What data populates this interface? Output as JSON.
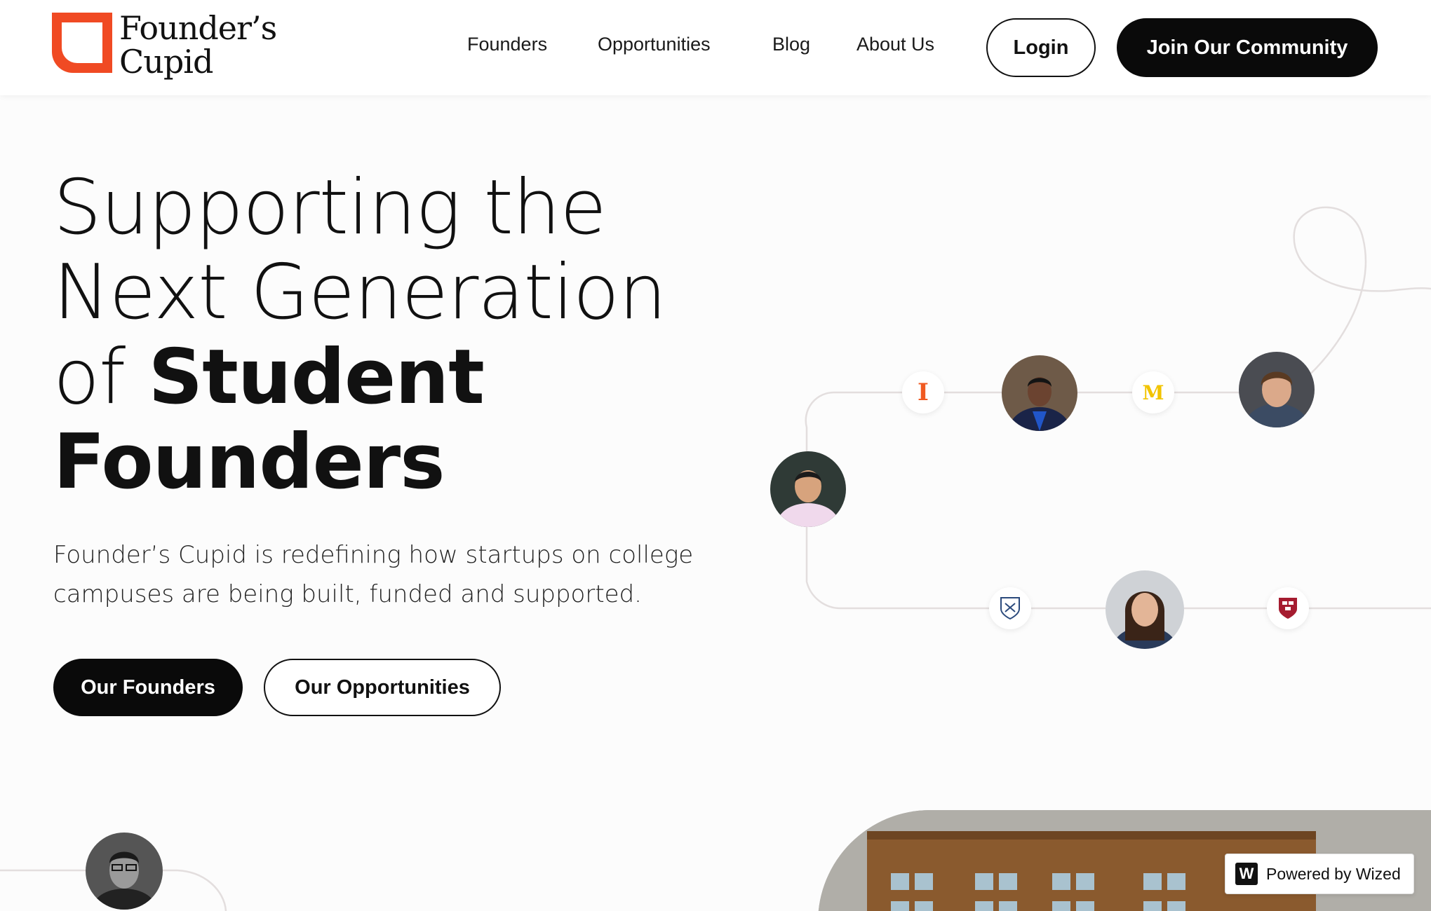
{
  "brand": {
    "line1": "Founder’s",
    "line2": "Cupid",
    "accent_color": "#f04a23"
  },
  "nav": {
    "links": [
      "Founders",
      "Opportunities",
      "Blog",
      "About Us"
    ],
    "login": "Login",
    "join": "Join Our Community"
  },
  "hero": {
    "title_line1": "Supporting the",
    "title_line2": "Next Generation",
    "title_line3_light": "of",
    "title_line3_bold": "Student",
    "title_line4_bold": "Founders",
    "subtitle": "Founder’s Cupid is redefining how startups on college campuses are being built, funded and supported.",
    "primary_button": "Our Founders",
    "secondary_button": "Our Opportunities"
  },
  "network": {
    "badges": [
      "illinois-logo",
      "michigan-logo",
      "yale-shield",
      "harvard-shield"
    ],
    "badge_letters": {
      "illinois": "I",
      "michigan": "M"
    }
  },
  "wized": {
    "label": "Powered by Wized",
    "icon_letter": "W"
  }
}
